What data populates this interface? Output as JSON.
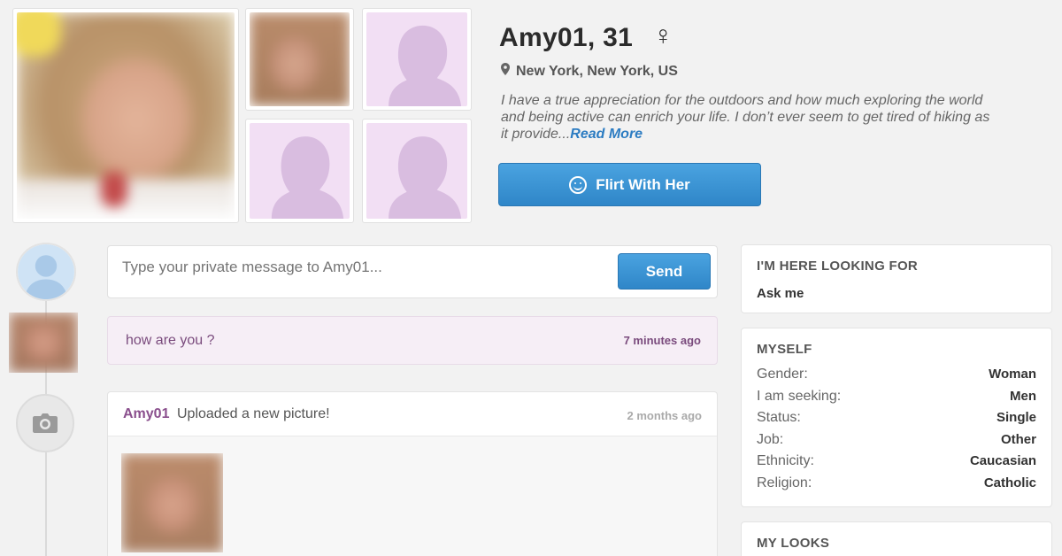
{
  "profile": {
    "name_age": "Amy01, 31",
    "gender_symbol": "♀",
    "location": "New York, New York, US",
    "bio": "I have a true appreciation for the outdoors and how much exploring the world and being active can enrich your life. I don’t ever seem to get tired of hiking as it provide...",
    "read_more": "Read More",
    "flirt_label": "Flirt With Her"
  },
  "message": {
    "placeholder": "Type your private message to Amy01...",
    "send_label": "Send"
  },
  "chat": {
    "text": "how are you ?",
    "time": "7 minutes ago"
  },
  "activity": {
    "user": "Amy01",
    "text": "Uploaded a new picture!",
    "time": "2 months ago"
  },
  "sidebar": {
    "looking_for": {
      "title": "I'M HERE LOOKING FOR",
      "value": "Ask me"
    },
    "myself": {
      "title": "MYSELF",
      "rows": [
        {
          "key": "Gender:",
          "value": "Woman"
        },
        {
          "key": "I am seeking:",
          "value": "Men"
        },
        {
          "key": "Status:",
          "value": "Single"
        },
        {
          "key": "Job:",
          "value": "Other"
        },
        {
          "key": "Ethnicity:",
          "value": "Caucasian"
        },
        {
          "key": "Religion:",
          "value": "Catholic"
        }
      ]
    },
    "my_looks": {
      "title": "MY LOOKS"
    }
  },
  "colors": {
    "accent_blue": "#2f86c8",
    "link_blue": "#2c7cc2",
    "purple_text": "#8a4f8d",
    "placeholder_pink": "#f2dff4"
  }
}
